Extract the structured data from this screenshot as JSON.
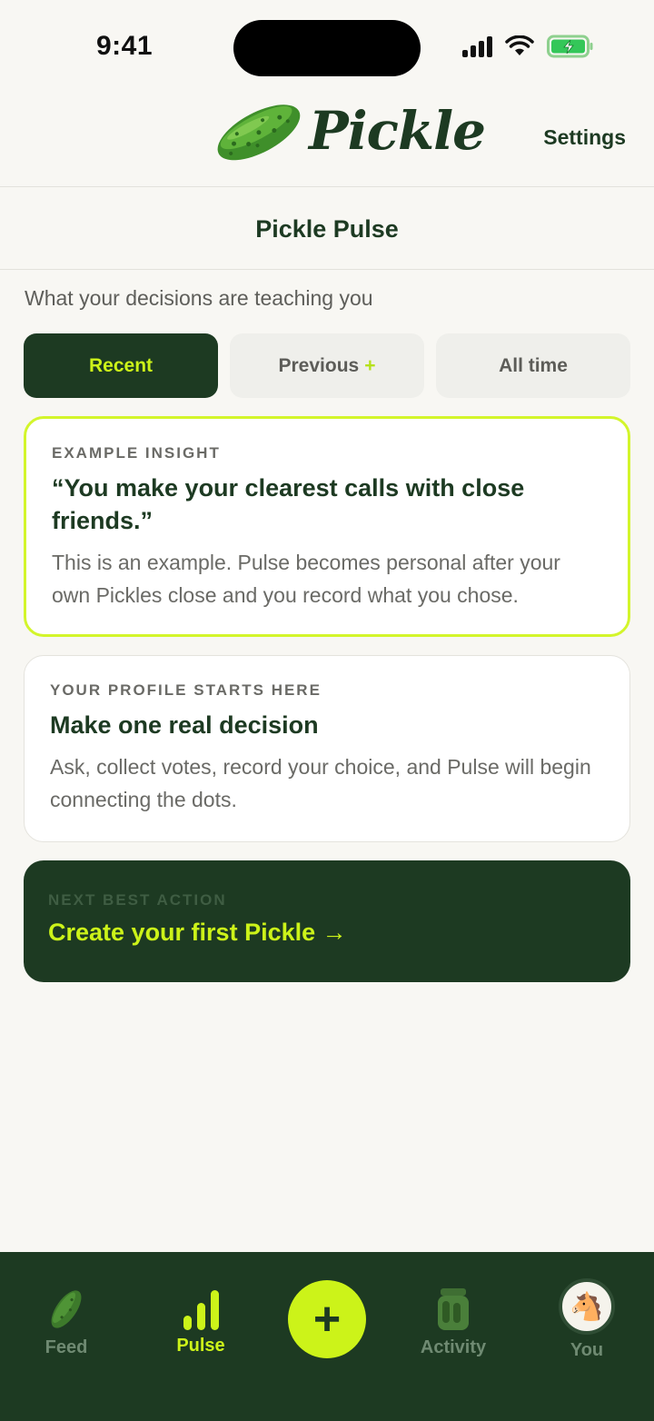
{
  "status_bar": {
    "time": "9:41"
  },
  "header": {
    "logo_text": "Pickle",
    "settings_label": "Settings"
  },
  "subheader": {
    "title": "Pickle Pulse",
    "tagline": "What your decisions are teaching you"
  },
  "tabs": [
    {
      "label": "Recent",
      "active": true
    },
    {
      "label": "Previous",
      "badge": "+",
      "active": false
    },
    {
      "label": "All time",
      "active": false
    }
  ],
  "cards": {
    "insight": {
      "eyebrow": "EXAMPLE INSIGHT",
      "title": "“You make your clearest calls with close friends.”",
      "body": "This is an example. Pulse becomes personal after your own Pickles close and you record what you chose."
    },
    "profile": {
      "eyebrow": "YOUR PROFILE STARTS HERE",
      "title": "Make one real decision",
      "body": "Ask, collect votes, record your choice, and Pulse will begin connecting the dots."
    },
    "action": {
      "eyebrow": "NEXT BEST ACTION",
      "link": "Create your first Pickle →"
    }
  },
  "nav": {
    "feed": "Feed",
    "pulse": "Pulse",
    "add": "+",
    "activity": "Activity",
    "you": "You",
    "active": "pulse"
  },
  "colors": {
    "brand_dark": "#1d3a22",
    "accent_lime": "#ccf319",
    "background": "#f8f7f3"
  },
  "icons": {
    "logo": "pickle-icon",
    "feed": "pickle-icon",
    "pulse": "bar-chart-icon",
    "add": "plus-icon",
    "activity": "jar-icon",
    "you": "horse-avatar-icon"
  }
}
